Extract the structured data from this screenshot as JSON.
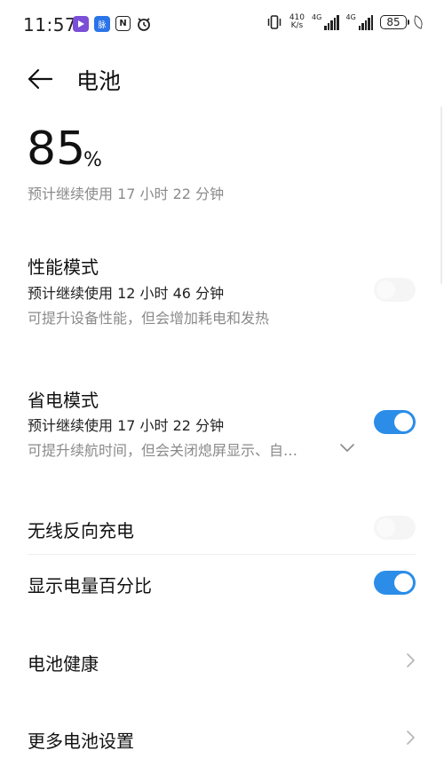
{
  "status_bar": {
    "time": "11:57",
    "app_badge_2": "脉",
    "app_badge_3": "N",
    "net_speed_value": "410",
    "net_speed_unit": "K/s",
    "sim1_label": "4G",
    "sim2_label": "4G",
    "battery_level": "85"
  },
  "header": {
    "title": "电池"
  },
  "battery": {
    "percent_value": "85",
    "percent_unit": "%",
    "remaining": "预计继续使用 17 小时 22 分钟"
  },
  "rows": {
    "performance": {
      "title": "性能模式",
      "subtitle": "预计继续使用 12 小时 46 分钟",
      "description": "可提升设备性能，但会增加耗电和发热",
      "enabled": false
    },
    "power_saving": {
      "title": "省电模式",
      "subtitle": "预计继续使用 17 小时 22 分钟",
      "description": "可提升续航时间，但会关闭熄屏显示、自…",
      "enabled": true
    },
    "reverse_charge": {
      "title": "无线反向充电",
      "enabled": false
    },
    "show_percent": {
      "title": "显示电量百分比",
      "enabled": true
    },
    "health": {
      "title": "电池健康"
    },
    "more": {
      "title": "更多电池设置"
    }
  },
  "colors": {
    "accent": "#2b8de8",
    "secondary_text": "#8a8a8a"
  }
}
